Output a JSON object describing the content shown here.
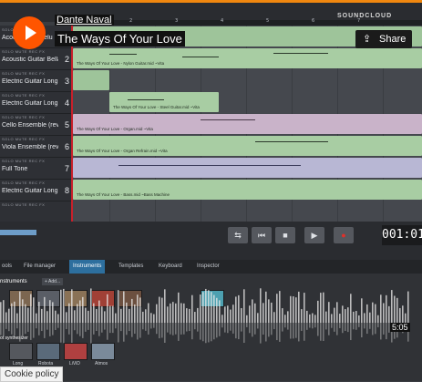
{
  "soundcloud": {
    "artist": "Dante Naval",
    "title": "The Ways Of Your Love",
    "share_label": "Share",
    "logo_text": "SOUNDCLOUD",
    "track_time": "5:05",
    "cookie_label": "Cookie policy",
    "brand_color": "#ff5500"
  },
  "ruler": {
    "markers": [
      "1",
      "2",
      "3",
      "4",
      "5",
      "6",
      "7"
    ]
  },
  "tracks": [
    {
      "controls": "SOLO  MUTE  REC  FX",
      "name": "Acoustic Gui Delu",
      "num": "1"
    },
    {
      "controls": "SOLO  MUTE  REC  FX",
      "name": "Acoustic Guitar Bella",
      "num": "2"
    },
    {
      "controls": "SOLO  MUTE  REC  FX",
      "name": "Electric Guitar Long",
      "num": "3"
    },
    {
      "controls": "SOLO  MUTE  REC  FX",
      "name": "Electric Guitar Long",
      "num": "4"
    },
    {
      "controls": "SOLO  MUTE  REC  FX",
      "name": "Cello Ensemble (rev",
      "num": "5"
    },
    {
      "controls": "SOLO  MUTE  REC  FX",
      "name": "Viola Ensemble (rev",
      "num": "6"
    },
    {
      "controls": "SOLO  MUTE  REC  FX",
      "name": "Full Tone",
      "num": "7"
    },
    {
      "controls": "SOLO  MUTE  REC  FX",
      "name": "Electric Guitar Long",
      "num": "8"
    },
    {
      "controls": "SOLO  MUTE  REC  FX",
      "name": "",
      "num": ""
    }
  ],
  "clips": [
    {
      "title": "The Ways Of Your Love - Nylon Guitar.mid ~Vita"
    },
    {
      "title": "The Ways Of Your Love - Steel Guitar.mid ~Vita"
    },
    {
      "title": "The Ways Of Your Love - Organ.mid ~Vita"
    },
    {
      "title": "The Ways Of Your Love - Organ Refrain.mid ~Vita"
    },
    {
      "title": "The Ways Of Your Love - Bass.mid ~Bass Machine"
    }
  ],
  "transport": {
    "timecode": "001:01",
    "loop_icon": "loop-icon",
    "rewind_icon": "rewind-icon",
    "stop_icon": "stop-icon",
    "play_icon": "play-icon",
    "record_icon": "record-icon"
  },
  "bottom_tabs": [
    "ools",
    "File manager",
    "Instruments",
    "Templates",
    "Keyboard",
    "Inspector"
  ],
  "panel": {
    "instruments_label": "nstruments",
    "add_label": "+ Add...",
    "soft_label": "ot synthesizer",
    "thumb_labels": [
      "Long",
      "Robota",
      "LiViD",
      "Atmos"
    ]
  }
}
